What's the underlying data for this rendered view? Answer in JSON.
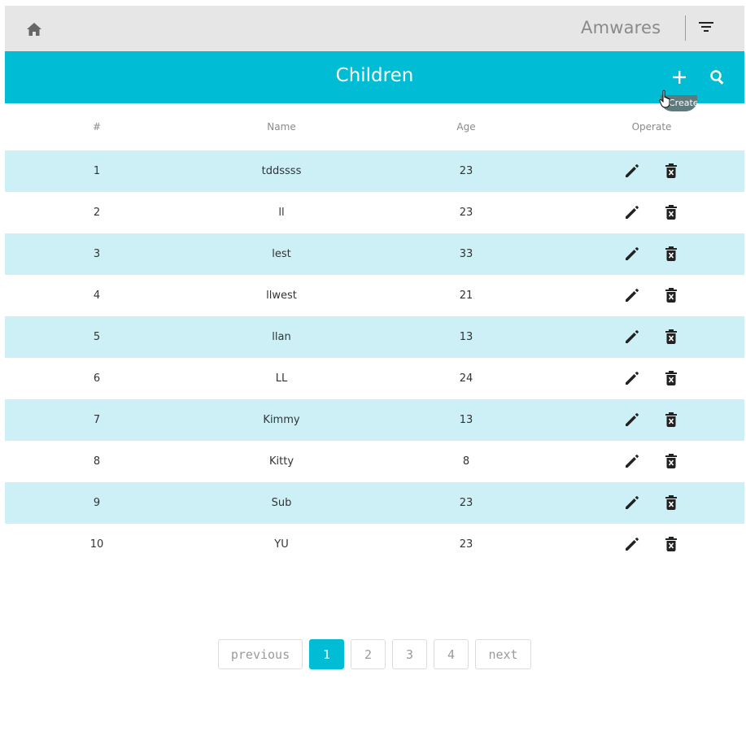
{
  "topbar": {
    "home_icon": "home-icon",
    "brand": "Amwares",
    "filter_icon": "filter-icon"
  },
  "header": {
    "title": "Children",
    "add_icon": "plus-icon",
    "search_icon": "search-icon",
    "tooltip": "Create",
    "accent_color": "#00bcd4"
  },
  "table": {
    "columns": [
      "#",
      "Name",
      "Age",
      "Operate"
    ],
    "row_shade_color": "#ccf0f5",
    "rows": [
      {
        "index": "1",
        "name": "tddssss",
        "age": "23"
      },
      {
        "index": "2",
        "name": "ll",
        "age": "23"
      },
      {
        "index": "3",
        "name": "lest",
        "age": "33"
      },
      {
        "index": "4",
        "name": "llwest",
        "age": "21"
      },
      {
        "index": "5",
        "name": "llan",
        "age": "13"
      },
      {
        "index": "6",
        "name": "LL",
        "age": "24"
      },
      {
        "index": "7",
        "name": "Kimmy",
        "age": "13"
      },
      {
        "index": "8",
        "name": "Kitty",
        "age": "8"
      },
      {
        "index": "9",
        "name": "Sub",
        "age": "23"
      },
      {
        "index": "10",
        "name": "YU",
        "age": "23"
      }
    ],
    "row_actions": [
      "edit-icon",
      "delete-icon"
    ]
  },
  "pagination": {
    "previous": "previous",
    "pages": [
      "1",
      "2",
      "3",
      "4"
    ],
    "current": "1",
    "next": "next"
  }
}
